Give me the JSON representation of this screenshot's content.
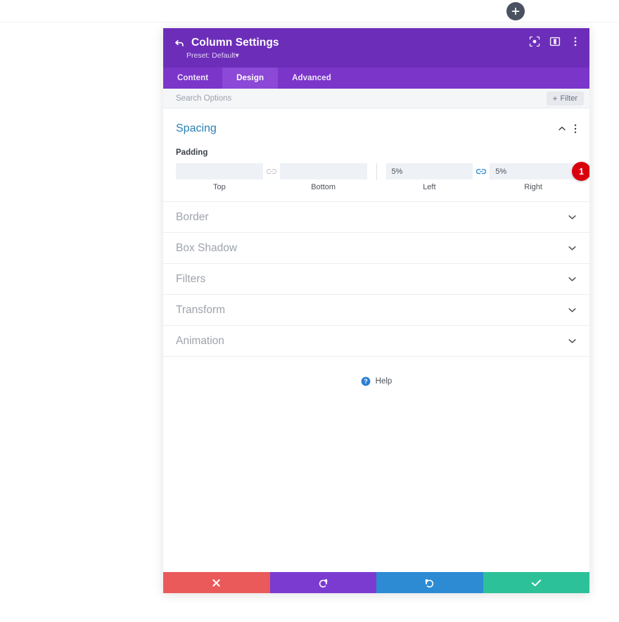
{
  "topbar": {
    "add_button": {
      "icon": "plus-icon",
      "label": "+"
    }
  },
  "modal": {
    "header": {
      "back_icon": "back-arrow-icon",
      "title": "Column Settings",
      "preset": "Preset: Default",
      "preset_caret": "▾",
      "icons": [
        {
          "name": "focus-target-icon",
          "label": "Focus"
        },
        {
          "name": "split-view-icon",
          "label": "Split View"
        },
        {
          "name": "more-options-icon",
          "label": "More Options"
        }
      ]
    },
    "tabs": [
      {
        "label": "Content",
        "active": false
      },
      {
        "label": "Design",
        "active": true
      },
      {
        "label": "Advanced",
        "active": false
      }
    ],
    "search": {
      "placeholder": "Search Options",
      "value": "",
      "filter_label": "Filter",
      "filter_plus": "+"
    },
    "sections": {
      "spacing": {
        "title": "Spacing",
        "expanded": true,
        "toggle_icon": "chevron-up-icon",
        "menu_icon": "more-options-icon",
        "field_label": "Padding",
        "badge": "1",
        "badge_color": "#d9000d",
        "fields": [
          {
            "caption": "Top",
            "value": "",
            "name": "padding-top-input"
          },
          {
            "caption": "Bottom",
            "value": "",
            "name": "padding-bottom-input"
          },
          {
            "caption": "Left",
            "value": "5%",
            "name": "padding-left-input"
          },
          {
            "caption": "Right",
            "value": "5%",
            "name": "padding-right-input"
          }
        ],
        "link_top_bottom": {
          "name": "link-top-bottom-icon",
          "linked": false,
          "color": "#c9ced6"
        },
        "link_left_right": {
          "name": "link-left-right-icon",
          "linked": true,
          "color": "#2d8bd4"
        }
      },
      "collapsed": [
        {
          "title": "Border",
          "icon": "chevron-down-icon"
        },
        {
          "title": "Box Shadow",
          "icon": "chevron-down-icon"
        },
        {
          "title": "Filters",
          "icon": "chevron-down-icon"
        },
        {
          "title": "Transform",
          "icon": "chevron-down-icon"
        },
        {
          "title": "Animation",
          "icon": "chevron-down-icon"
        }
      ]
    },
    "help": {
      "icon": "help-circle-icon",
      "label": "Help"
    },
    "actions": [
      {
        "name": "cancel-button",
        "icon": "close-x-icon",
        "color": "#ea5a5a"
      },
      {
        "name": "undo-button",
        "icon": "undo-arrow-icon",
        "color": "#7b3bd1"
      },
      {
        "name": "redo-button",
        "icon": "redo-arrow-icon",
        "color": "#2d8bd4"
      },
      {
        "name": "save-button",
        "icon": "check-icon",
        "color": "#2dc19a"
      }
    ]
  },
  "theme": {
    "header_purple": "#6c2eb9",
    "tabbar_purple": "#7b35c9",
    "tab_active_purple": "#8c48d6",
    "section_title_blue": "#2a7fb5"
  }
}
